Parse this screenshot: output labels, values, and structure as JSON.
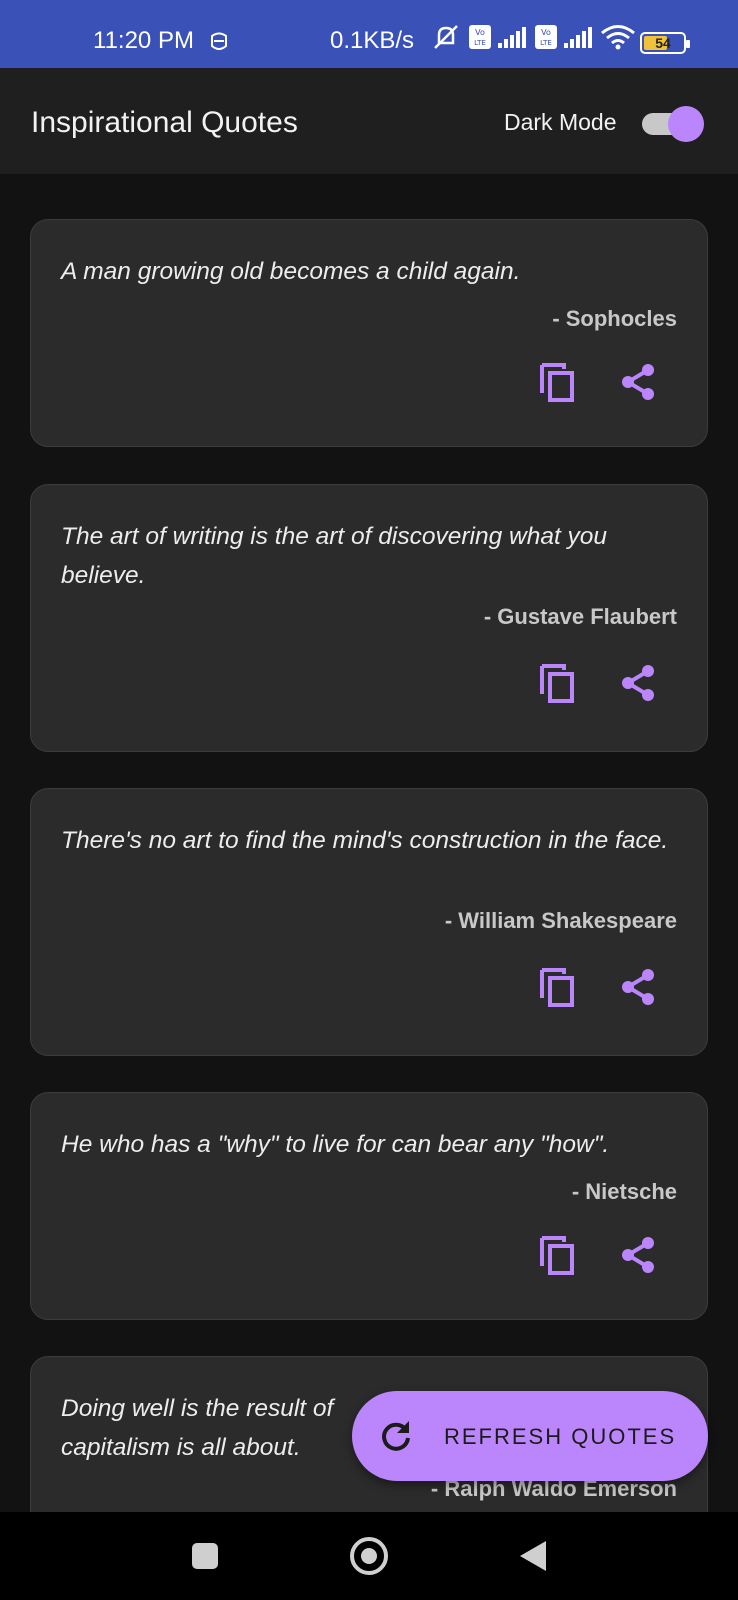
{
  "status_bar": {
    "time": "11:20 PM",
    "net_speed": "0.1KB/s",
    "sim1": "Vo LTE",
    "sim2": "Vo LTE",
    "battery": "54",
    "icons": [
      "alarm-icon",
      "mute-icon",
      "signal-icon",
      "wifi-icon",
      "battery-icon"
    ]
  },
  "app_bar": {
    "title": "Inspirational Quotes",
    "dark_mode_label": "Dark Mode",
    "dark_mode_on": true
  },
  "quotes": [
    {
      "text": "A man growing old becomes a child again.",
      "author": "- Sophocles"
    },
    {
      "text": "The art of writing is the art of discovering what you believe.",
      "author": "- Gustave Flaubert"
    },
    {
      "text": "There's no art to find the mind's construction in the face.",
      "author": "- William Shakespeare"
    },
    {
      "text": "He who has a \"why\" to live for can bear any \"how\".",
      "author": "- Nietsche"
    },
    {
      "text": "Doing well is the result of",
      "text_line2": "capitalism is all about.",
      "author": "- Ralph Waldo Emerson"
    }
  ],
  "fab": {
    "label": "REFRESH QUOTES",
    "icon": "refresh-icon"
  },
  "colors": {
    "accent": "#bb86fc",
    "status_bar": "#3a51b8",
    "card": "#2b2b2b",
    "background": "#121212"
  }
}
